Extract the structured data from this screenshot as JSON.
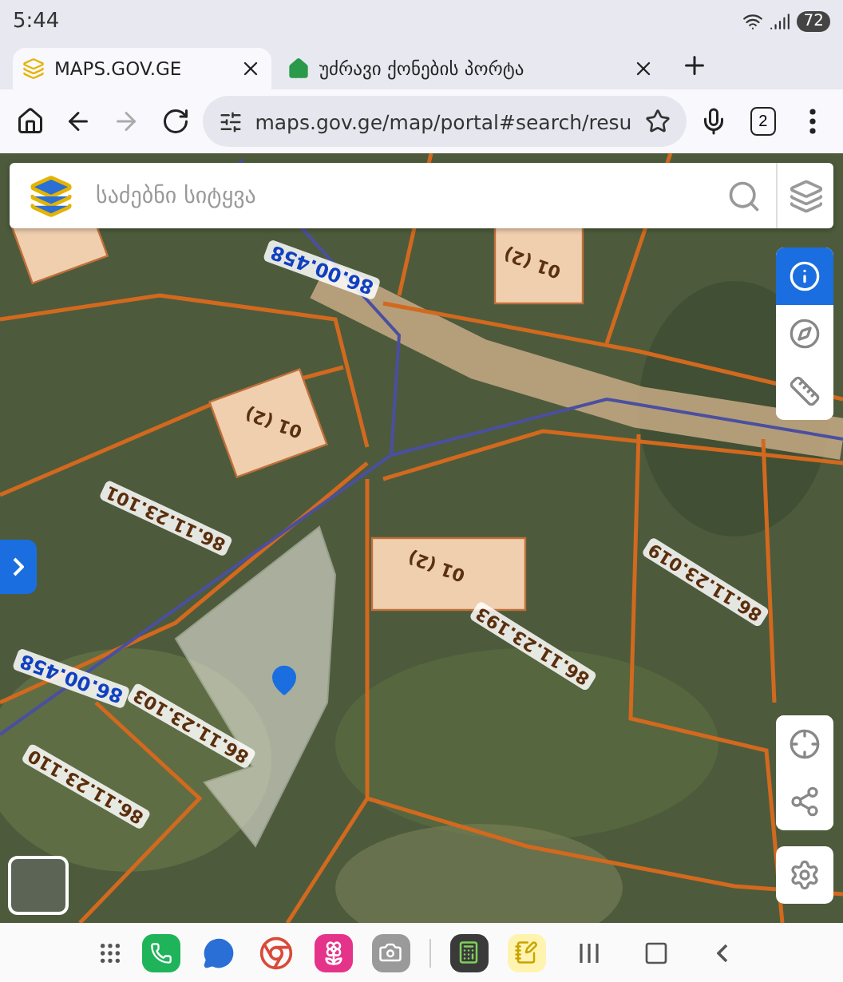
{
  "status_bar": {
    "time": "5:44",
    "battery": "72"
  },
  "tabs": [
    {
      "title": "MAPS.GOV.GE",
      "selected": true
    },
    {
      "title": "უძრავი ქონების პორტა",
      "selected": false
    }
  ],
  "address_bar": {
    "url": "maps.gov.ge/map/portal#search/resu",
    "tab_count": "2"
  },
  "search": {
    "placeholder": "საძებნი სიტყვა"
  },
  "map_tools": [
    {
      "kind": "info",
      "selected": true
    },
    {
      "kind": "compass",
      "selected": false
    },
    {
      "kind": "measure",
      "selected": false
    }
  ],
  "map_labels": [
    {
      "kind": "road",
      "text": "86.00.458"
    },
    {
      "kind": "road",
      "text": "86.00.458"
    },
    {
      "kind": "building",
      "text": "01 (2)"
    },
    {
      "kind": "building",
      "text": "01 (2)"
    },
    {
      "kind": "building",
      "text": "01 (2)"
    },
    {
      "kind": "parcel",
      "text": "86.11.23.101"
    },
    {
      "kind": "parcel",
      "text": "86.11.23.103"
    },
    {
      "kind": "parcel",
      "text": "86.11.23.110"
    },
    {
      "kind": "parcel",
      "text": "86.11.23.193"
    },
    {
      "kind": "parcel",
      "text": "86.11.23.019"
    }
  ]
}
